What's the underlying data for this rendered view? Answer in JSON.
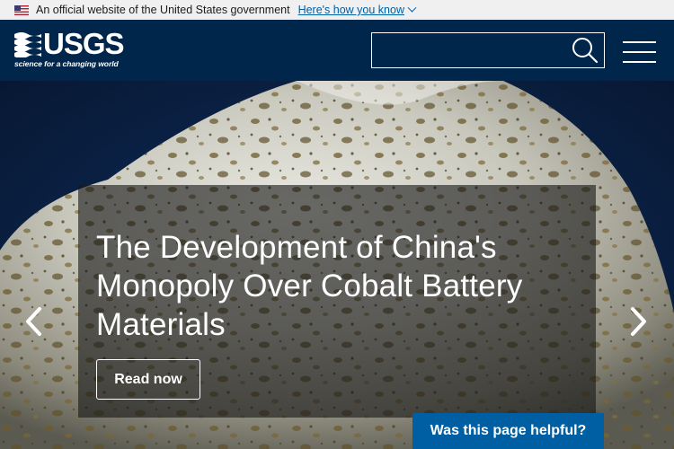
{
  "gov_banner": {
    "text": "An official website of the United States government",
    "link": "Here's how you know"
  },
  "header": {
    "logo_word": "USGS",
    "logo_tagline": "science for a changing world",
    "search": {
      "value": "",
      "placeholder": ""
    }
  },
  "hero": {
    "slide_title": "The Development of China's Monopoly Over Cobalt Battery Materials",
    "read_now_label": "Read now",
    "feedback_label": "Was this page helpful?"
  },
  "colors": {
    "header_bg": "#00264c",
    "banner_bg": "#f0f0f0",
    "link": "#005ea2",
    "feedback_bg": "#005ea2"
  },
  "icons": [
    "us-flag-icon",
    "chevron-down-icon",
    "usgs-logo-icon",
    "search-icon",
    "hamburger-menu-icon",
    "chevron-left-icon",
    "chevron-right-icon"
  ]
}
